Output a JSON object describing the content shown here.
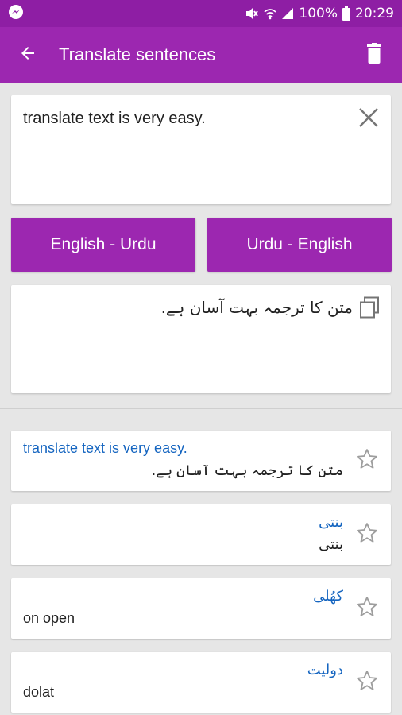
{
  "status_bar": {
    "left_icon": "messenger-icon",
    "battery": "100%",
    "time": "20:29",
    "icons": [
      "mute-icon",
      "wifi-icon",
      "signal-icon",
      "battery-icon"
    ]
  },
  "app_bar": {
    "title": "Translate sentences",
    "back_icon": "arrow-left-icon",
    "delete_icon": "trash-icon",
    "color": "#9c27b0"
  },
  "input": {
    "value": "translate text is very easy.",
    "clear_icon": "close-icon"
  },
  "buttons": {
    "english_urdu": "English - Urdu",
    "urdu_english": "Urdu - English"
  },
  "result": {
    "text": "متن کا ترجمہ بہت آسان ہے.",
    "copy_icon": "copy-icon"
  },
  "history": [
    {
      "source": "translate text is very easy.",
      "translation": "متن کا ترجمہ بہت آسان ہے.",
      "icon": "star-icon"
    },
    {
      "source": "بنتی",
      "translation": "بنتی",
      "icon": "star-icon"
    },
    {
      "source": "کھُلی",
      "translation": "on open",
      "icon": "star-icon"
    },
    {
      "source": "دولیت",
      "translation": "dolat",
      "icon": "star-icon"
    }
  ]
}
